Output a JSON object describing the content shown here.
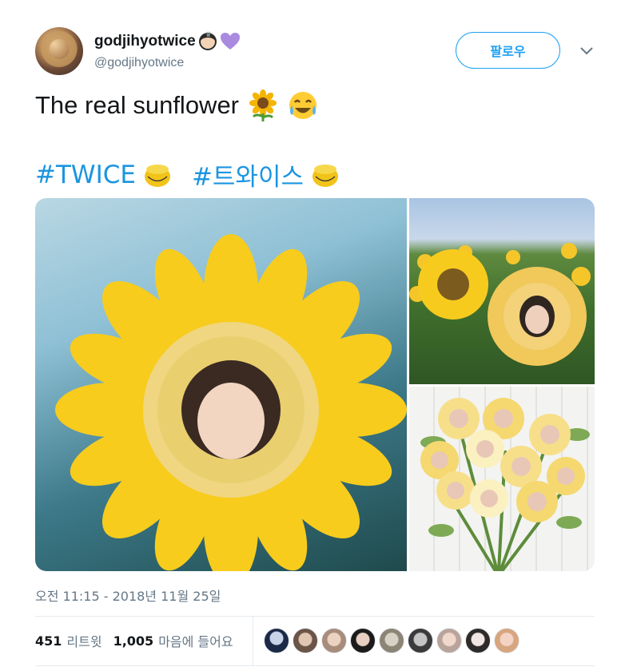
{
  "user": {
    "display_name": "godjihyotwice",
    "handle": "@godjihyotwice",
    "follow_label": "팔로우",
    "name_emojis": [
      "woman-with-crown-emoji",
      "purple-heart-emoji"
    ]
  },
  "tweet": {
    "text": "The real sunflower",
    "text_emojis": [
      "sunflower-emoji",
      "tears-of-joy-emoji"
    ],
    "hashtags": [
      "#TWICE",
      "#트와이스"
    ],
    "timestamp": "오전 11:15 - 2018년 11월 25일"
  },
  "stats": {
    "retweets_count": "451",
    "retweets_label": "리트윗",
    "likes_count": "1,005",
    "likes_label": "마음에 들어요"
  },
  "likers": [
    "liker-avatar-1",
    "liker-avatar-2",
    "liker-avatar-3",
    "liker-avatar-4",
    "liker-avatar-5",
    "liker-avatar-6",
    "liker-avatar-7",
    "liker-avatar-8",
    "liker-avatar-9"
  ],
  "colors": {
    "accent": "#1da1f2",
    "hashtag": "#1b95e0",
    "secondary_text": "#657786",
    "primary_text": "#14171a",
    "divider": "#e6ecf0"
  }
}
